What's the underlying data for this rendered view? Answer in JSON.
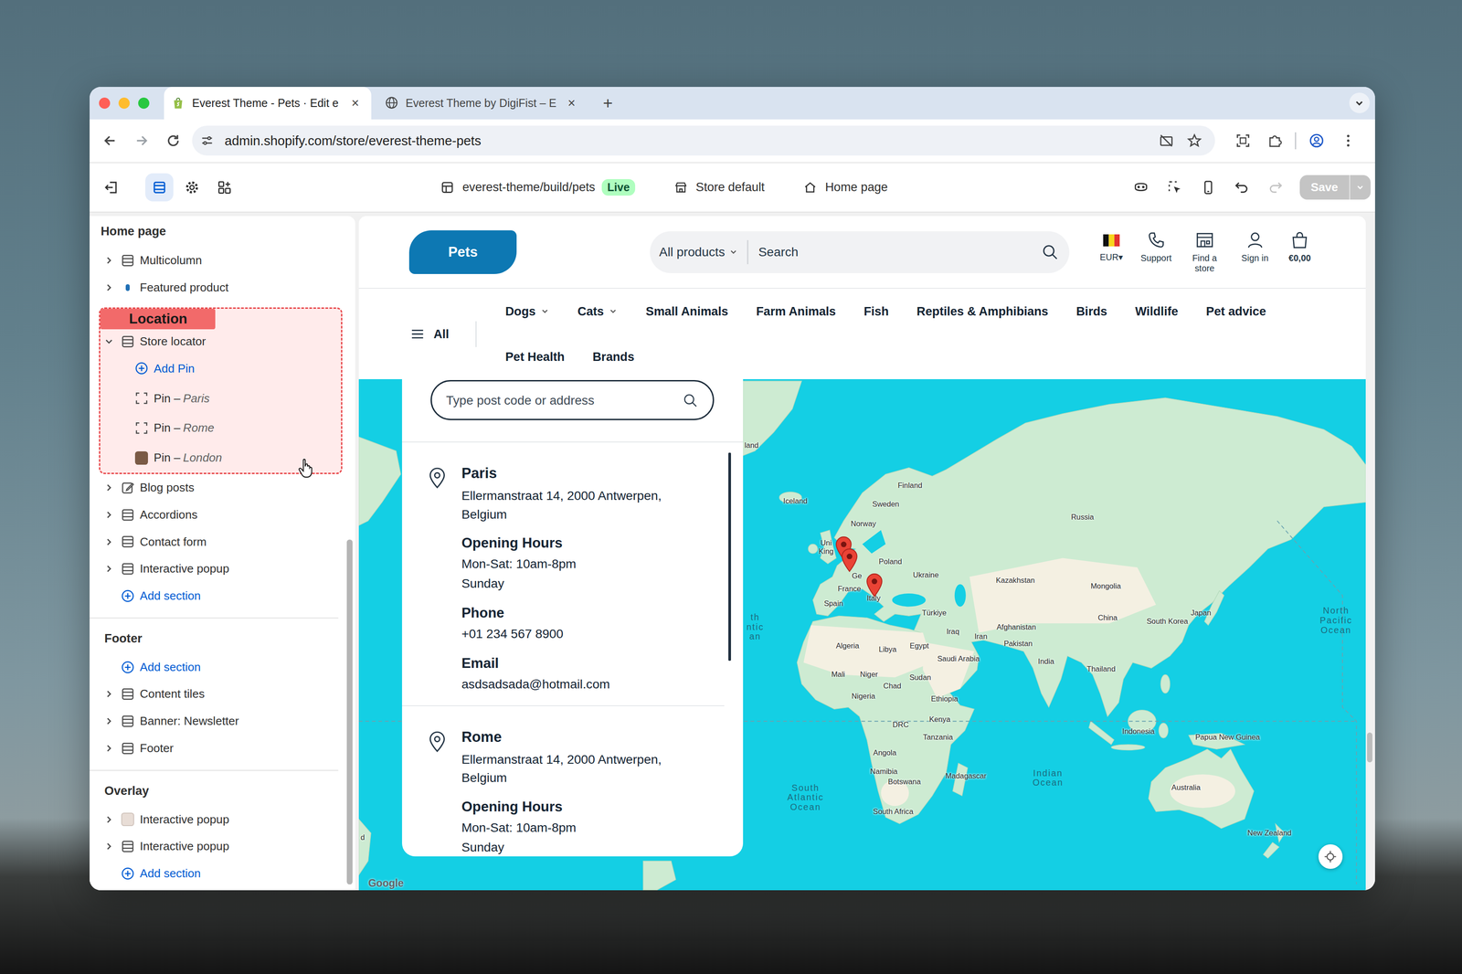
{
  "browser": {
    "tabs": [
      {
        "title": "Everest Theme - Pets · Edit e",
        "kind": "shopify",
        "selected": true,
        "close": "×"
      },
      {
        "title": "Everest Theme by DigiFist – E",
        "kind": "web",
        "selected": false,
        "close": "×"
      }
    ],
    "new_tab": "+",
    "url": "admin.shopify.com/store/everest-theme-pets"
  },
  "toolbar": {
    "tools": [
      {
        "kind": "sections",
        "selected": true
      },
      {
        "kind": "settings",
        "selected": false
      },
      {
        "kind": "apps",
        "selected": false
      }
    ],
    "theme": "everest-theme/build/pets",
    "badge": "Live",
    "store": "Store default",
    "page": "Home page",
    "undo_disabled": false,
    "redo_disabled": true,
    "save": {
      "label": "Save",
      "disabled": true
    }
  },
  "sidebar": {
    "groups": [
      {
        "title": "Home page",
        "items": [
          {
            "label": "Multicolumn",
            "kind": "section",
            "expanded": false
          },
          {
            "label": "Featured product",
            "kind": "product",
            "expanded": false
          },
          {
            "label": "Store locator",
            "kind": "section",
            "expanded": true,
            "annotation": "Location",
            "children": [
              {
                "label": "Add Pin",
                "kind": "add"
              },
              {
                "label": "Pin –",
                "detail": "Paris",
                "kind": "block"
              },
              {
                "label": "Pin –",
                "detail": "Rome",
                "kind": "block"
              },
              {
                "label": "Pin –",
                "detail": "London",
                "kind": "block-image"
              }
            ]
          },
          {
            "label": "Blog posts",
            "kind": "blog",
            "expanded": false
          },
          {
            "label": "Accordions",
            "kind": "section",
            "expanded": false
          },
          {
            "label": "Contact form",
            "kind": "section",
            "expanded": false
          },
          {
            "label": "Interactive popup",
            "kind": "section",
            "expanded": false
          },
          {
            "label": "Add section",
            "kind": "add"
          }
        ]
      },
      {
        "title": "Footer",
        "items": [
          {
            "label": "Add section",
            "kind": "add"
          },
          {
            "label": "Content tiles",
            "kind": "section",
            "expanded": false
          },
          {
            "label": "Banner: Newsletter",
            "kind": "section",
            "expanded": false
          },
          {
            "label": "Footer",
            "kind": "section",
            "expanded": false
          }
        ]
      },
      {
        "title": "Overlay",
        "items": [
          {
            "label": "Interactive popup",
            "kind": "image",
            "expanded": false
          },
          {
            "label": "Interactive popup",
            "kind": "section",
            "expanded": false
          },
          {
            "label": "Add section",
            "kind": "add"
          }
        ]
      }
    ]
  },
  "storefront": {
    "logo": "Pets",
    "search": {
      "category": "All products",
      "placeholder": "Search"
    },
    "currency": "EUR▾",
    "actions": [
      {
        "kind": "support",
        "label": "Support"
      },
      {
        "kind": "store",
        "label": "Find a store"
      },
      {
        "kind": "account",
        "label": "Sign in"
      },
      {
        "kind": "cart",
        "label": "€0,00"
      }
    ],
    "menu_label": "All",
    "nav": [
      {
        "label": "Dogs",
        "dropdown": true
      },
      {
        "label": "Cats",
        "dropdown": true
      },
      {
        "label": "Small Animals",
        "dropdown": false
      },
      {
        "label": "Farm Animals",
        "dropdown": false
      },
      {
        "label": "Fish",
        "dropdown": false
      },
      {
        "label": "Reptiles & Amphibians",
        "dropdown": false
      },
      {
        "label": "Birds",
        "dropdown": false
      },
      {
        "label": "Wildlife",
        "dropdown": false
      },
      {
        "label": "Pet advice",
        "dropdown": false
      },
      {
        "label": "Pet Health",
        "dropdown": false
      },
      {
        "label": "Brands",
        "dropdown": false
      }
    ]
  },
  "locator": {
    "placeholder": "Type post code or address",
    "stores": [
      {
        "name": "Paris",
        "address": "Ellermanstraat 14, 2000 Antwerpen, Belgium",
        "details": [
          {
            "title": "Opening Hours",
            "lines": [
              "Mon-Sat: 10am-8pm",
              "Sunday"
            ]
          },
          {
            "title": "Phone",
            "lines": [
              "+01 234 567 8900"
            ]
          },
          {
            "title": "Email",
            "lines": [
              "asdsadsada@hotmail.com"
            ]
          }
        ]
      },
      {
        "name": "Rome",
        "address": "Ellermanstraat 14, 2000 Antwerpen, Belgium",
        "details": [
          {
            "title": "Opening Hours",
            "lines": [
              "Mon-Sat: 10am-8pm",
              "Sunday"
            ]
          }
        ]
      }
    ]
  },
  "map": {
    "labels": [
      {
        "text": "land",
        "kind": "country"
      },
      {
        "text": "Iceland",
        "kind": "country"
      },
      {
        "text": "Finland",
        "kind": "country"
      },
      {
        "text": "Sweden",
        "kind": "country"
      },
      {
        "text": "Norway",
        "kind": "country"
      },
      {
        "text": "Russia",
        "kind": "country"
      },
      {
        "text": "Uni",
        "kind": "country"
      },
      {
        "text": "King",
        "kind": "country"
      },
      {
        "text": "Poland",
        "kind": "country"
      },
      {
        "text": "Ge",
        "kind": "country"
      },
      {
        "text": "France",
        "kind": "country"
      },
      {
        "text": "Ukraine",
        "kind": "country"
      },
      {
        "text": "Kazakhstan",
        "kind": "country"
      },
      {
        "text": "Mongolia",
        "kind": "country"
      },
      {
        "text": "Spain",
        "kind": "country"
      },
      {
        "text": "Italy",
        "kind": "country"
      },
      {
        "text": "Türkiye",
        "kind": "country"
      },
      {
        "text": "Iraq",
        "kind": "country"
      },
      {
        "text": "Iran",
        "kind": "country"
      },
      {
        "text": "Afghanistan",
        "kind": "country"
      },
      {
        "text": "China",
        "kind": "country"
      },
      {
        "text": "South Korea",
        "kind": "country"
      },
      {
        "text": "Japan",
        "kind": "country"
      },
      {
        "text": "Pakistan",
        "kind": "country"
      },
      {
        "text": "India",
        "kind": "country"
      },
      {
        "text": "Algeria",
        "kind": "country"
      },
      {
        "text": "Libya",
        "kind": "country"
      },
      {
        "text": "Egypt",
        "kind": "country"
      },
      {
        "text": "Saudi Arabia",
        "kind": "country"
      },
      {
        "text": "Mali",
        "kind": "country"
      },
      {
        "text": "Niger",
        "kind": "country"
      },
      {
        "text": "Chad",
        "kind": "country"
      },
      {
        "text": "Sudan",
        "kind": "country"
      },
      {
        "text": "Nigeria",
        "kind": "country"
      },
      {
        "text": "Ethiopia",
        "kind": "country"
      },
      {
        "text": "Thailand",
        "kind": "country"
      },
      {
        "text": "Kenya",
        "kind": "country"
      },
      {
        "text": "DRC",
        "kind": "country"
      },
      {
        "text": "Tanzania",
        "kind": "country"
      },
      {
        "text": "Indonesia",
        "kind": "country"
      },
      {
        "text": "Papua New Guinea",
        "kind": "country"
      },
      {
        "text": "Angola",
        "kind": "country"
      },
      {
        "text": "Namibia",
        "kind": "country"
      },
      {
        "text": "Botswana",
        "kind": "country"
      },
      {
        "text": "Madagascar",
        "kind": "country"
      },
      {
        "text": "South Africa",
        "kind": "country"
      },
      {
        "text": "Australia",
        "kind": "country"
      },
      {
        "text": "New Zealand",
        "kind": "country"
      },
      {
        "text": "Indian Ocean",
        "kind": "ocean"
      },
      {
        "text": "South Atlantic Ocean",
        "kind": "ocean"
      },
      {
        "text": "North Pacific Ocean",
        "kind": "ocean"
      },
      {
        "text": "th ntic an",
        "kind": "ocean"
      },
      {
        "text": "d",
        "kind": "country"
      }
    ],
    "pins": [
      {
        "kind": "marker"
      },
      {
        "kind": "marker"
      },
      {
        "kind": "marker"
      }
    ],
    "attribution": "Google"
  }
}
